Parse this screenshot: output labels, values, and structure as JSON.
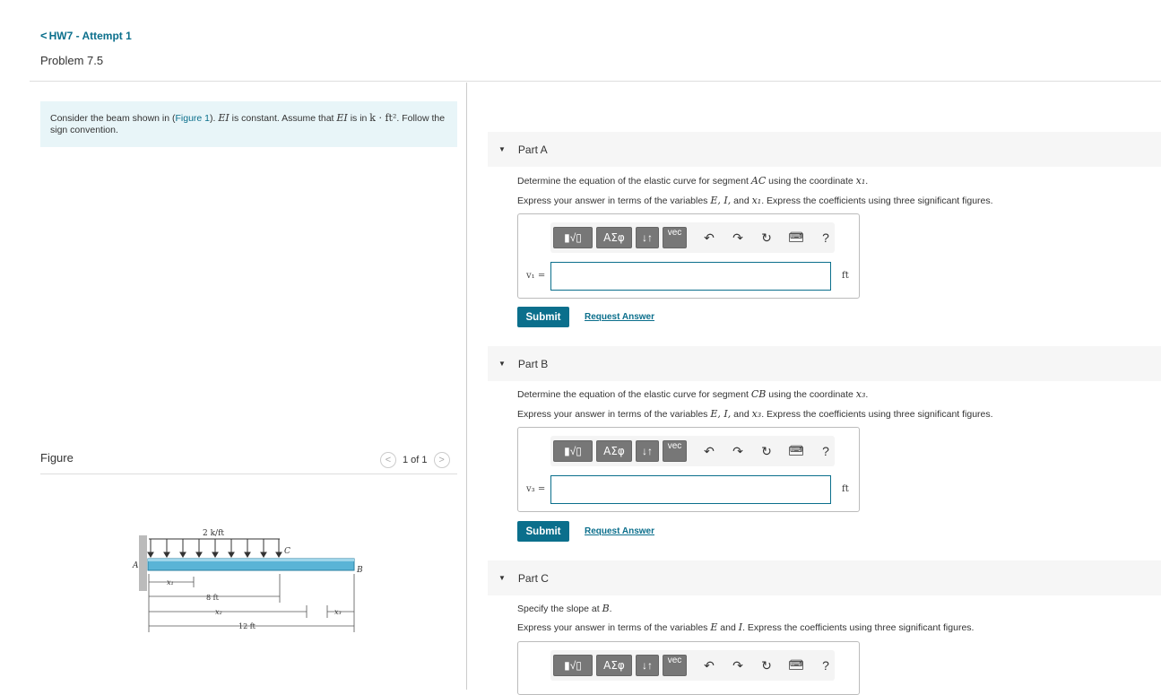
{
  "header": {
    "back_label": "HW7 - Attempt 1",
    "back_chevron": "<",
    "problem_title": "Problem 7.5"
  },
  "intro": {
    "text_1": "Consider the beam shown in (",
    "figure_link": "Figure 1",
    "text_2": "). ",
    "ei_1": "EI",
    "text_3": " is constant. Assume that ",
    "ei_2": "EI",
    "text_4": " is in ",
    "units": "k · ft²",
    "text_5": ". Follow the sign convention."
  },
  "figure": {
    "label": "Figure",
    "counter": "1 of 1",
    "prev_glyph": "<",
    "next_glyph": ">",
    "load_label": "2 k/ft",
    "label_A": "A",
    "label_B": "B",
    "label_C": "C",
    "dim_x1": "x₁",
    "dim_8ft": "8 ft",
    "dim_x2": "x₂",
    "dim_12ft": "12 ft",
    "dim_x3": "x₃"
  },
  "toolbar": {
    "b1": "▮√▯",
    "b2": "ΑΣφ",
    "b3": "↓↑",
    "b4": "vec",
    "undo": "↶",
    "redo": "↷",
    "reset": "↻",
    "keyboard": "⌨",
    "help": "?"
  },
  "parts": [
    {
      "label": "Part A",
      "determine_pre": "Determine the equation of the elastic curve for segment ",
      "determine_seg": "AC",
      "determine_mid": " using the coordinate ",
      "determine_var": "x₁",
      "determine_end": ".",
      "express_pre": "Express your answer in terms of the variables ",
      "express_vars": "E, I,",
      "express_and": " and ",
      "express_var2": "x₁",
      "express_end": ". Express the coefficients using three significant figures.",
      "var_label": "v₁ =",
      "value": "",
      "unit": "ft",
      "submit": "Submit",
      "request": "Request Answer"
    },
    {
      "label": "Part B",
      "determine_pre": "Determine the equation of the elastic curve for segment ",
      "determine_seg": "CB",
      "determine_mid": " using the coordinate ",
      "determine_var": "x₃",
      "determine_end": ".",
      "express_pre": "Express your answer in terms of the variables ",
      "express_vars": "E, I,",
      "express_and": " and ",
      "express_var2": "x₃",
      "express_end": ". Express the coefficients using three significant figures.",
      "var_label": "v₃ =",
      "value": "",
      "unit": "ft",
      "submit": "Submit",
      "request": "Request Answer"
    },
    {
      "label": "Part C",
      "determine_pre": "Specify the slope at ",
      "determine_seg": "B",
      "determine_end": ".",
      "express_pre": "Express your answer in terms of the variables ",
      "express_vars": "E",
      "express_and": " and ",
      "express_var2": "I",
      "express_end": ". Express the coefficients using three significant figures."
    }
  ],
  "colors": {
    "accent": "#0b6f8c",
    "intro_bg": "#e8f5f8",
    "beam": "#5ab4d6"
  }
}
